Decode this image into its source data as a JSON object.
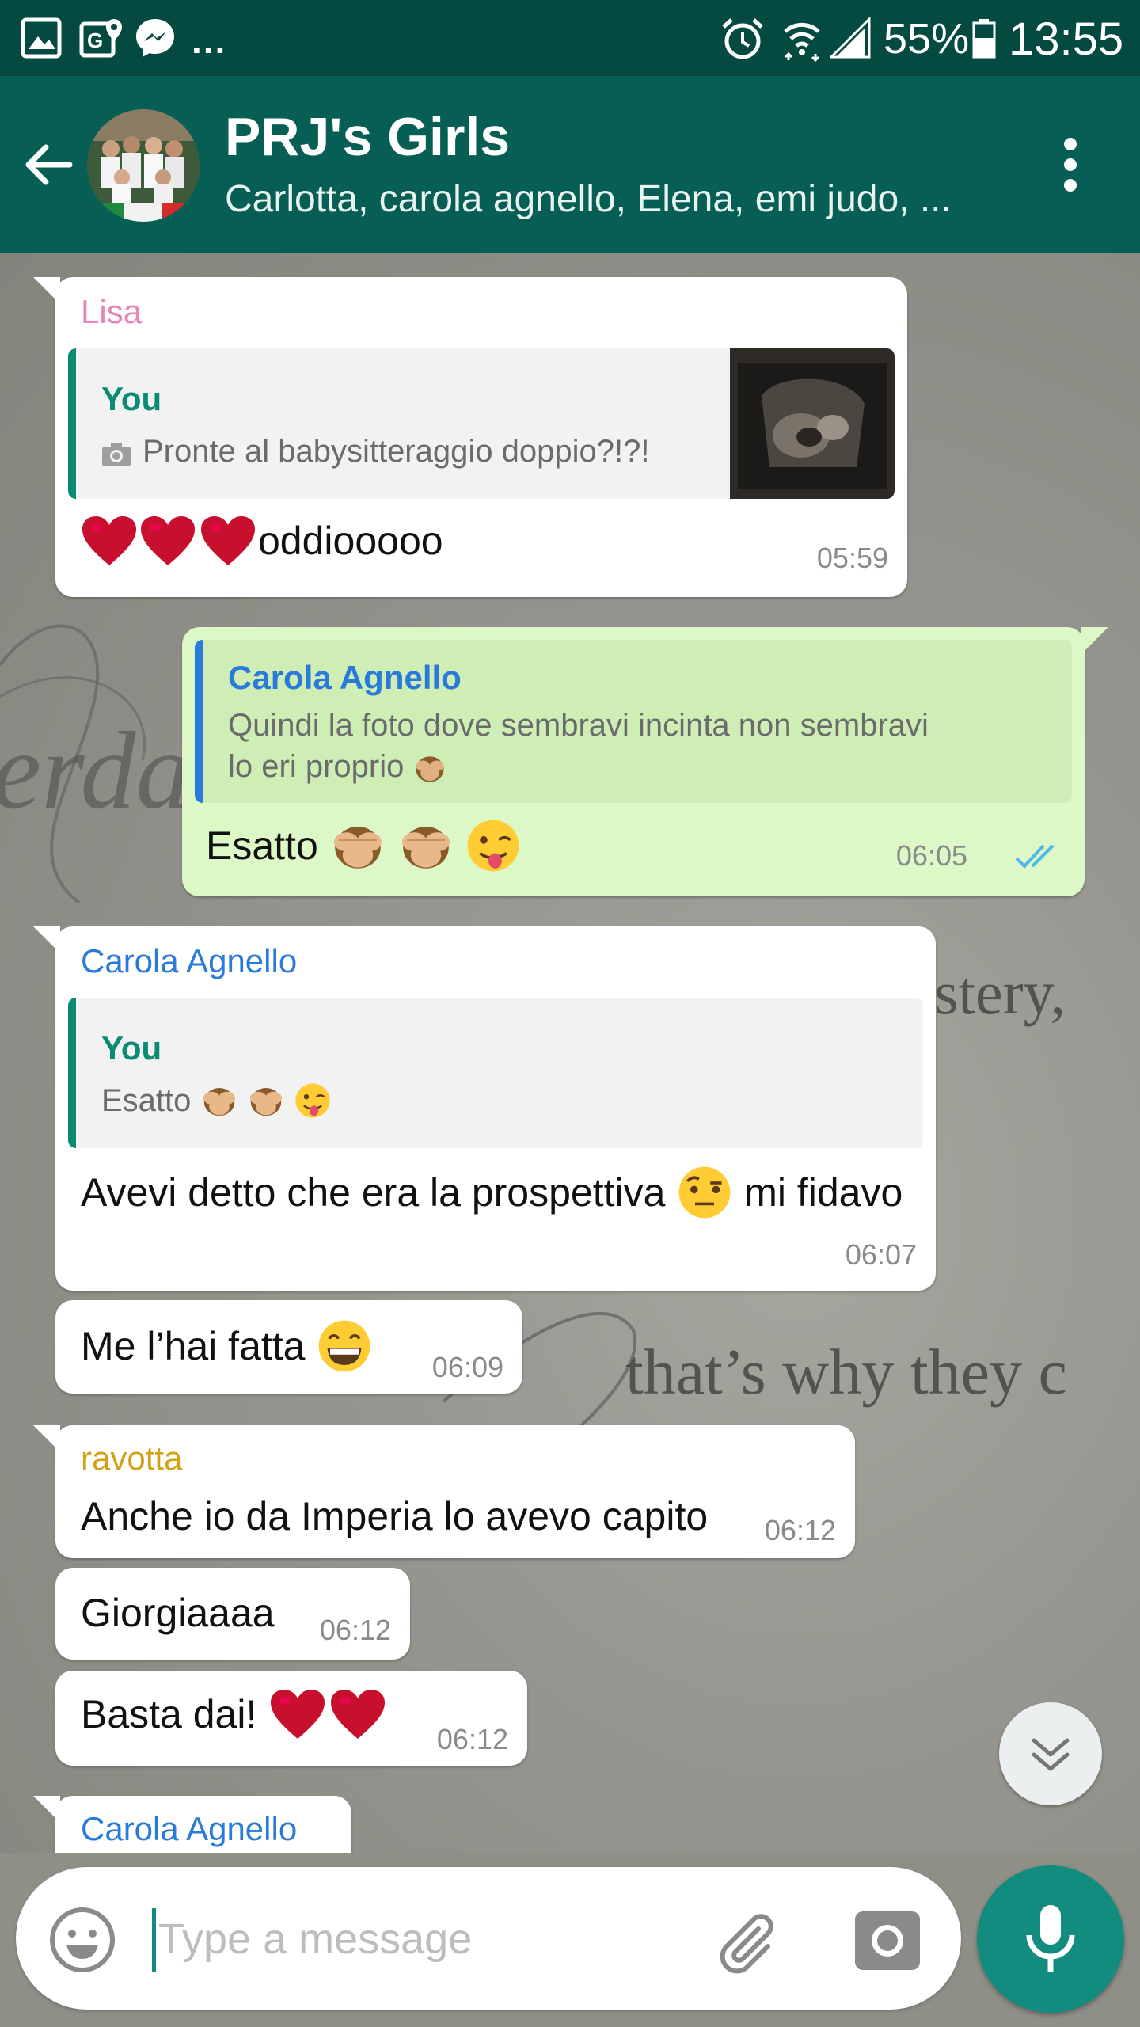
{
  "status_bar": {
    "more": "...",
    "battery": "55%",
    "time": "13:55"
  },
  "header": {
    "title": "PRJ's Girls",
    "members": "Carlotta, carola agnello, Elena, emi judo, ..."
  },
  "messages": [
    {
      "sender": "Lisa",
      "sender_color": "#e786b5",
      "quote_author": "You",
      "quote_text": "Pronte al babysitteraggio doppio?!?!",
      "text": "oddiooooo",
      "time": "05:59"
    },
    {
      "quote_author": "Carola Agnello",
      "quote_line1": "Quindi la foto dove sembravi incinta non sembravi",
      "quote_line2": "lo eri proprio",
      "text": "Esatto",
      "time": "06:05",
      "status": "read"
    },
    {
      "sender": "Carola Agnello",
      "sender_color": "#2a7ad9",
      "quote_author": "You",
      "quote_text": "Esatto",
      "text_before": "Avevi detto che era la prospettiva",
      "text_after": "mi fidavo",
      "time": "06:07"
    },
    {
      "text": "Me l’hai fatta",
      "time": "06:09"
    },
    {
      "sender": "ravotta",
      "sender_color": "#d4a017",
      "text": "Anche io da Imperia lo avevo capito",
      "time": "06:12"
    },
    {
      "text": "Giorgiaaaa",
      "time": "06:12"
    },
    {
      "text": "Basta dai!",
      "time": "06:12"
    },
    {
      "sender": "Carola Agnello",
      "sender_color": "#2a7ad9"
    }
  ],
  "wallpaper_text": {
    "word1": "stery,",
    "word2": "that’s why they c",
    "script": "erda"
  },
  "composer": {
    "placeholder": "Type a message"
  },
  "colors": {
    "header": "#075e54",
    "status_bar": "#044a40",
    "accent": "#128c7e",
    "outgoing": "#dcf8c6",
    "you": "#0b8a74",
    "read_ticks": "#4fb6ec"
  }
}
